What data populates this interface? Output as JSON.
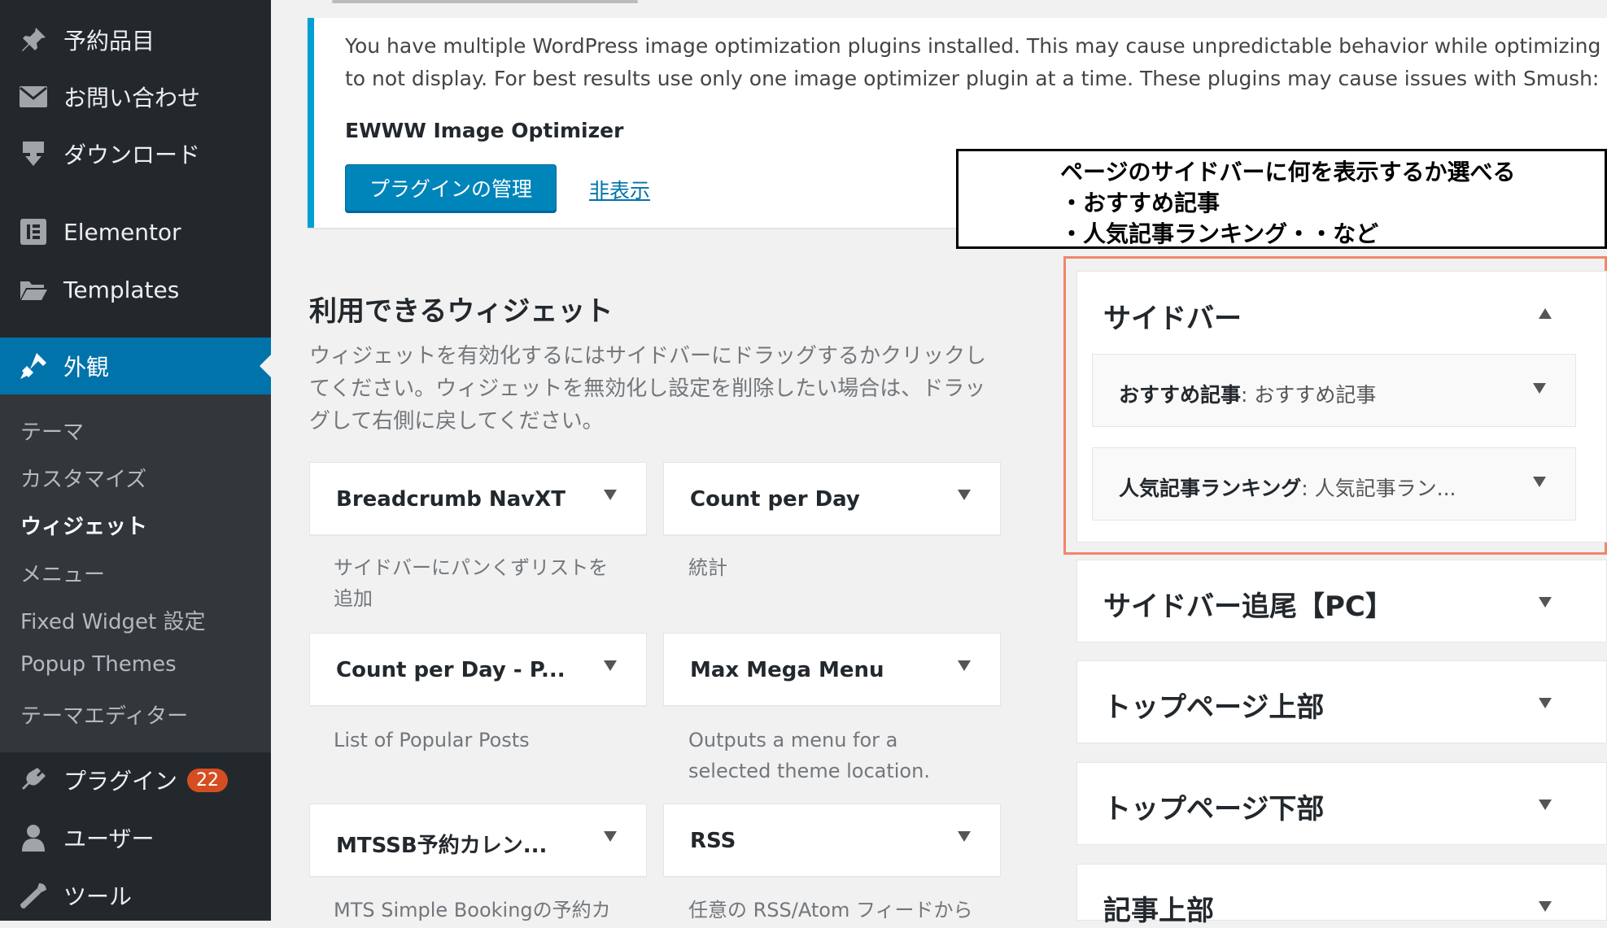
{
  "admin_menu": {
    "items": [
      {
        "label": "予約品目",
        "icon": "pin-icon"
      },
      {
        "label": "お問い合わせ",
        "icon": "mail-icon"
      },
      {
        "label": "ダウンロード",
        "icon": "download-icon"
      },
      {
        "label": "Elementor",
        "icon": "elementor-icon"
      },
      {
        "label": "Templates",
        "icon": "folder-icon"
      },
      {
        "label": "外観",
        "icon": "brush-icon"
      },
      {
        "label": "プラグイン",
        "icon": "plug-icon",
        "badge": "22"
      },
      {
        "label": "ユーザー",
        "icon": "user-icon"
      },
      {
        "label": "ツール",
        "icon": "wrench-icon"
      }
    ],
    "submenu": [
      "テーマ",
      "カスタマイズ",
      "ウィジェット",
      "メニュー",
      "Fixed Widget 設定",
      "Popup Themes",
      "テーマエディター"
    ],
    "current_submenu": "ウィジェット",
    "accent_color": "#0073aa",
    "badge_color": "#d54e21"
  },
  "notice": {
    "line1": "You have multiple WordPress image optimization plugins installed. This may cause unpredictable behavior while optimizing y",
    "line2": "to not display. For best results use only one image optimizer plugin at a time. These plugins may cause issues with Smush:",
    "plugin": "EWWW Image Optimizer",
    "manage_button": "プラグインの管理",
    "hide_link": "非表示",
    "border_color": "#00a0d2"
  },
  "annotation": {
    "line1": "ページのサイドバーに何を表示するか選べる",
    "line2": "・おすすめ記事",
    "line3": "・人気記事ランキング・・など"
  },
  "available_widgets": {
    "title": "利用できるウィジェット",
    "description": "ウィジェットを有効化するにはサイドバーにドラッグするかクリックしてください。ウィジェットを無効化し設定を削除したい場合は、ドラッグして右側に戻してください。",
    "widgets": [
      {
        "title": "Breadcrumb NavXT",
        "desc": "サイドバーにパンくずリストを追加"
      },
      {
        "title": "Count per Day",
        "desc": "統計"
      },
      {
        "title": "Count per Day - P...",
        "desc": "List of Popular Posts"
      },
      {
        "title": "Max Mega Menu",
        "desc": "Outputs a menu for a selected theme location."
      },
      {
        "title": "MTSSB予約カレン...",
        "desc": "MTS Simple Bookingの予約カ"
      },
      {
        "title": "RSS",
        "desc": "任意の RSS/Atom フィードから"
      }
    ]
  },
  "widget_areas": {
    "sidebar": {
      "title": "サイドバー",
      "widgets": [
        {
          "name": "おすすめ記事",
          "subtitle": ": おすすめ記事"
        },
        {
          "name": "人気記事ランキング",
          "subtitle": ": 人気記事ラン..."
        }
      ],
      "highlight_color": "#f0876a"
    },
    "others": [
      "サイドバー追尾【PC】",
      "トップページ上部",
      "トップページ下部",
      "記事上部"
    ]
  }
}
